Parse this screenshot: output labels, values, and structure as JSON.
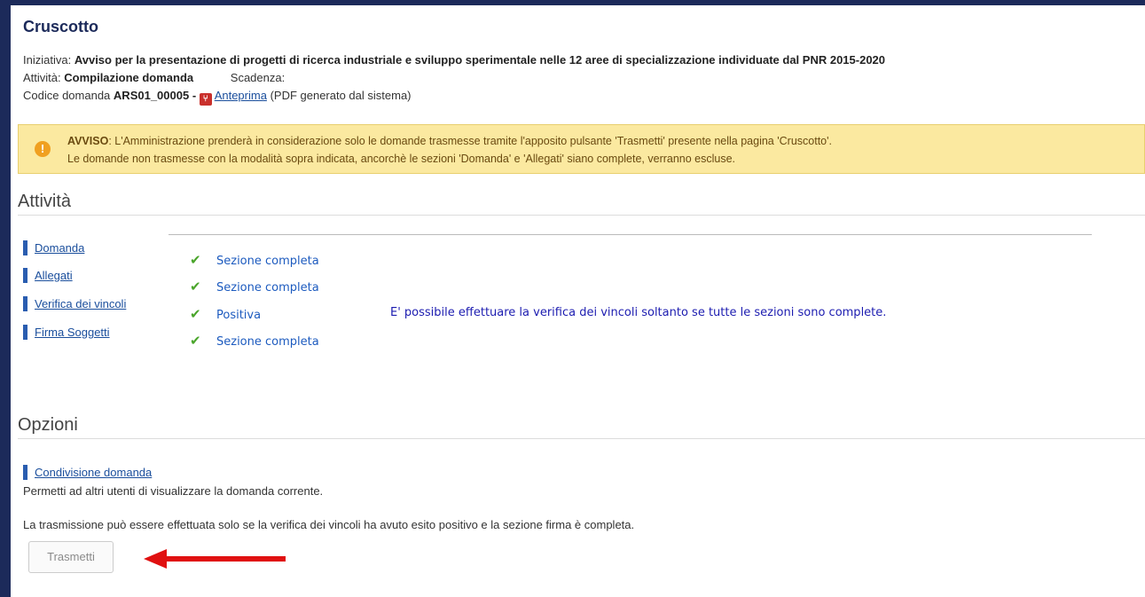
{
  "page": {
    "title": "Cruscotto"
  },
  "meta": {
    "iniziativa_label": "Iniziativa:",
    "iniziativa_value": "Avviso per la presentazione di progetti di ricerca industriale e sviluppo sperimentale nelle 12 aree di specializzazione individuate dal PNR 2015-2020",
    "attivita_label": "Attività:",
    "attivita_value": "Compilazione domanda",
    "scadenza_label": "Scadenza:",
    "codice_label": "Codice domanda",
    "codice_value": "ARS01_00005 -",
    "anteprima_link": "Anteprima",
    "anteprima_note": "(PDF generato dal sistema)"
  },
  "notice": {
    "title": "AVVISO",
    "line1": ": L'Amministrazione prenderà in considerazione solo le domande trasmesse tramite l'apposito pulsante 'Trasmetti' presente nella pagina 'Cruscotto'.",
    "line2": "Le domande non trasmesse con la modalità sopra indicata, ancorchè le sezioni 'Domanda' e 'Allegati' siano complete, verranno escluse."
  },
  "attivita": {
    "heading": "Attività",
    "items": [
      {
        "label": "Domanda",
        "status": "Sezione completa"
      },
      {
        "label": "Allegati",
        "status": "Sezione completa"
      },
      {
        "label": "Verifica dei vincoli",
        "status": "Positiva"
      },
      {
        "label": "Firma Soggetti",
        "status": "Sezione completa"
      }
    ],
    "vincoli_message": "E' possibile effettuare la verifica dei vincoli soltanto se tutte le sezioni sono complete."
  },
  "opzioni": {
    "heading": "Opzioni",
    "condivisione_link": "Condivisione domanda",
    "condivisione_desc": "Permetti ad altri utenti di visualizzare la domanda corrente.",
    "trasmissione_note": "La trasmissione può essere effettuata solo se la verifica dei vincoli ha avuto esito positivo e la sezione firma è completa.",
    "trasmetti_button": "Trasmetti"
  },
  "colors": {
    "accent": "#2a5db0",
    "status_blue": "#1d5bbf",
    "check_green": "#4aa52b",
    "notice_bg": "#fbe9a0",
    "arrow_red": "#e01010"
  }
}
